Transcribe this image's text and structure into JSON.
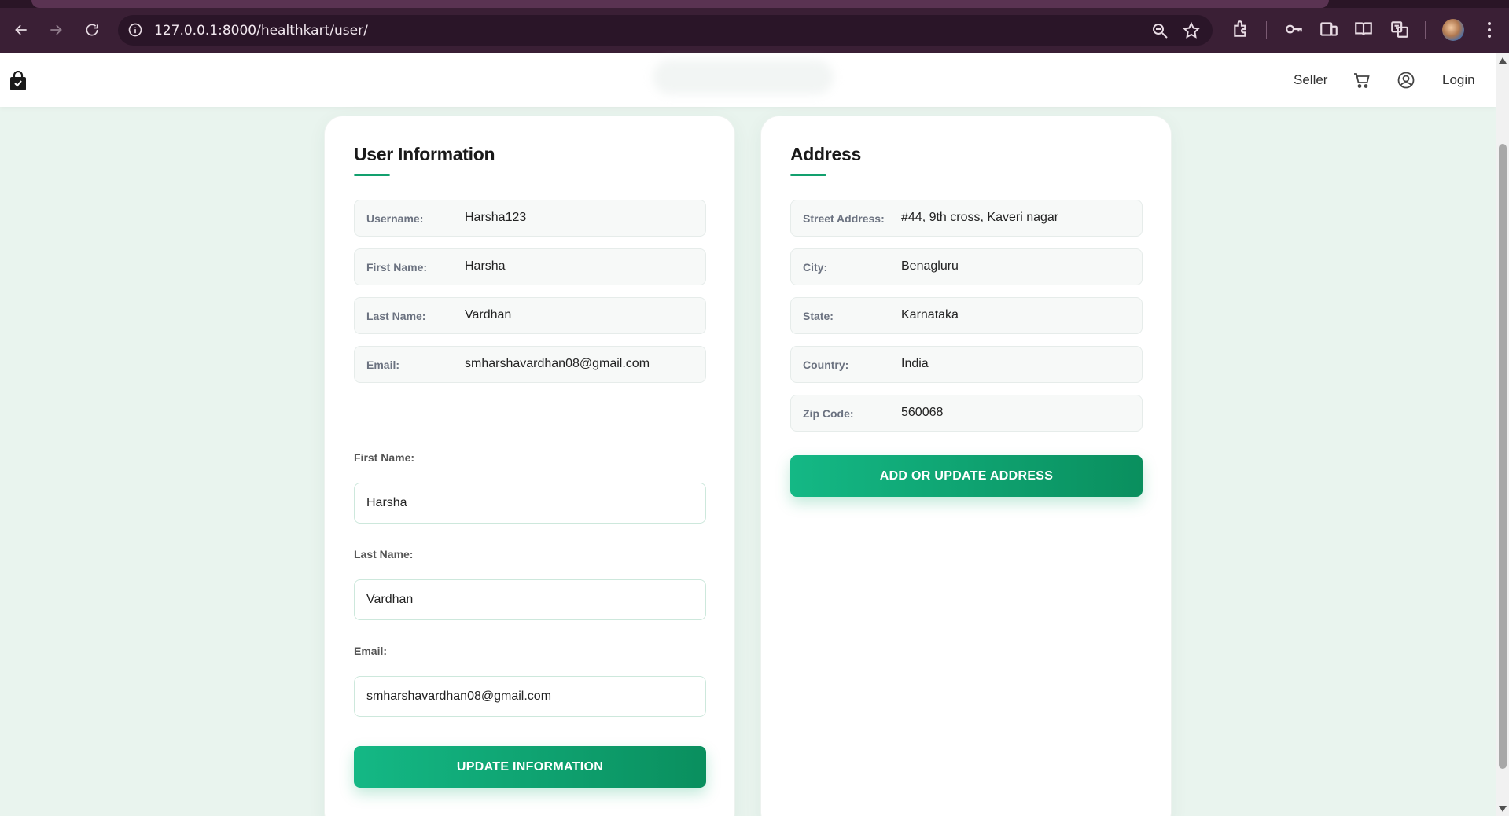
{
  "browser": {
    "url": "127.0.0.1:8000/healthkart/user/"
  },
  "header": {
    "seller_label": "Seller",
    "login_label": "Login"
  },
  "user_info": {
    "title": "User Information",
    "rows": [
      {
        "label": "Username:",
        "value": "Harsha123"
      },
      {
        "label": "First Name:",
        "value": "Harsha"
      },
      {
        "label": "Last Name:",
        "value": "Vardhan"
      },
      {
        "label": "Email:",
        "value": "smharshavardhan08@gmail.com"
      }
    ],
    "form": {
      "first_name_label": "First Name:",
      "first_name_value": "Harsha",
      "last_name_label": "Last Name:",
      "last_name_value": "Vardhan",
      "email_label": "Email:",
      "email_value": "smharshavardhan08@gmail.com",
      "submit_label": "UPDATE INFORMATION"
    }
  },
  "address": {
    "title": "Address",
    "rows": [
      {
        "label": "Street Address:",
        "value": "#44, 9th cross, Kaveri nagar"
      },
      {
        "label": "City:",
        "value": "Benagluru"
      },
      {
        "label": "State:",
        "value": "Karnataka"
      },
      {
        "label": "Country:",
        "value": "India"
      },
      {
        "label": "Zip Code:",
        "value": "560068"
      }
    ],
    "button_label": "ADD OR UPDATE ADDRESS"
  },
  "colors": {
    "accent": "#12a06e",
    "browser_frame": "#3a1f35"
  }
}
